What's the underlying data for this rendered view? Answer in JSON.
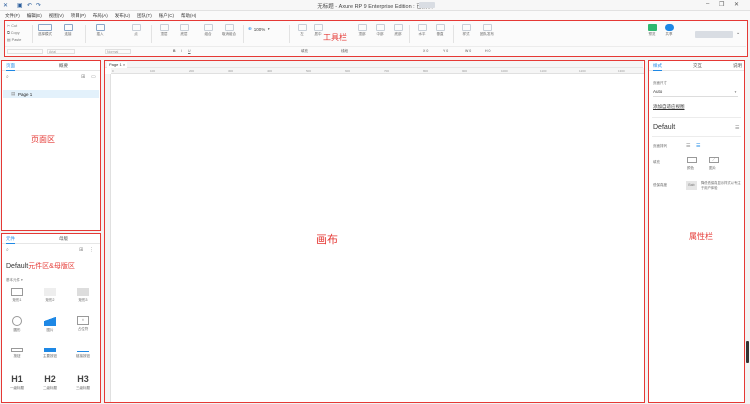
{
  "window": {
    "title": "无标题 - Axure RP 9 Enterprise Edition : 已授权",
    "controls": [
      "minimize-icon",
      "restore-icon",
      "close-icon"
    ]
  },
  "menu": [
    "文件(F)",
    "编辑(E)",
    "视图(V)",
    "项目(P)",
    "布局(A)",
    "发布(U)",
    "团队(T)",
    "账户(C)",
    "帮助(H)"
  ],
  "clipboard": {
    "cut": "Cut",
    "copy": "Copy",
    "paste": "Paste"
  },
  "toolbar": {
    "annotation": "工具栏",
    "items": [
      "选择模式",
      "连接",
      "插入",
      "点",
      "顶层",
      "底层",
      "组合",
      "取消组合",
      "左",
      "居中",
      "右",
      "顶部",
      "中部",
      "底部",
      "水平",
      "垂直",
      "样式",
      "左对齐",
      "居中",
      "发布",
      "团队发布"
    ],
    "zoom": "100%",
    "preview_label": "预览",
    "share_label": "共享",
    "sub_fill": "填充",
    "sub_line": "线段",
    "sub_x": "X",
    "sub_y": "Y",
    "sub_w": "W",
    "sub_h": "H",
    "sub_x_value": "0",
    "sub_y_value": "0",
    "sub_w_value": "0",
    "sub_h_value": "0",
    "font_family": "Arial",
    "font_style": "Normal"
  },
  "pages_panel": {
    "tab_pages": "页面",
    "tab_outline": "概要",
    "page1": "Page 1",
    "annotation": "页面区"
  },
  "libs_panel": {
    "tab_libraries": "元件",
    "tab_masters": "母版",
    "library_name": "Default",
    "annotation": "元件区&母版区",
    "category": "基本元件 ▾",
    "items": [
      {
        "label": "矩形1",
        "shape": "rect"
      },
      {
        "label": "矩形2",
        "shape": "rect-gray"
      },
      {
        "label": "矩形3",
        "shape": "rect-dark"
      },
      {
        "label": "圆形",
        "shape": "circle"
      },
      {
        "label": "图片",
        "shape": "image"
      },
      {
        "label": "占位符",
        "shape": "placeholder"
      },
      {
        "label": "按钮",
        "shape": "button"
      },
      {
        "label": "主要按钮",
        "shape": "primary"
      },
      {
        "label": "链接按钮",
        "shape": "link"
      },
      {
        "label": "一级标题",
        "shape": "H1"
      },
      {
        "label": "二级标题",
        "shape": "H2"
      },
      {
        "label": "三级标题",
        "shape": "H3"
      }
    ]
  },
  "canvas": {
    "tab": "Page 1",
    "annotation": "画布",
    "ruler": [
      "0",
      "100",
      "200",
      "300",
      "400",
      "500",
      "600",
      "700",
      "800",
      "900",
      "1000",
      "1100",
      "1200",
      "1300"
    ]
  },
  "props_panel": {
    "tab_style": "样式",
    "tab_interactions": "交互",
    "tab_notes": "说明",
    "page_size_label": "页面尺寸",
    "page_size_value": "Auto",
    "add_adaptive": "添加自适应视图",
    "default_style": "Default",
    "align_label": "页面排列",
    "fill_label": "填充",
    "fill_color": "颜色",
    "fill_image": "图片",
    "low_fidelity_label": "低保真度",
    "low_fidelity_text": "降低低保真显示样式以专注于用户体验",
    "annotation": "属性栏"
  },
  "colors": {
    "accent": "#1e88e5",
    "annotation": "#e53935",
    "preview": "#2eb870"
  }
}
